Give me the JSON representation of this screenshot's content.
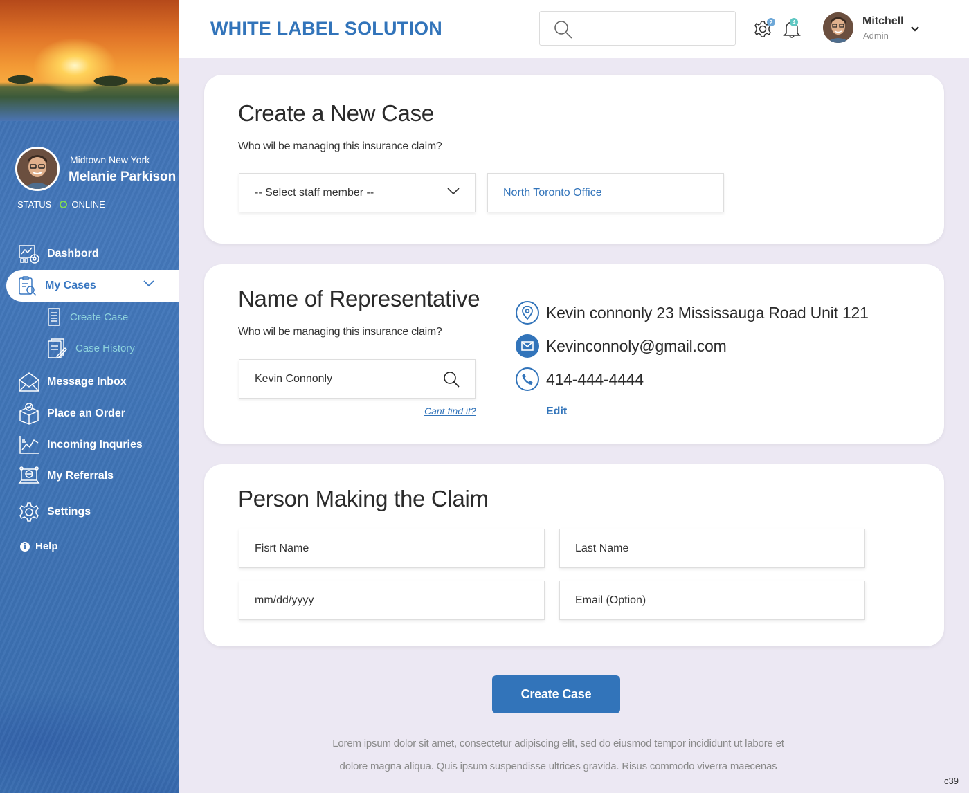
{
  "header": {
    "brand": "WHITE LABEL SOLUTION",
    "search_placeholder": "",
    "settings_badge": "2",
    "notifications_badge": "4",
    "user_name": "Mitchell",
    "user_role": "Admin"
  },
  "sidebar": {
    "location": "Midtown New York",
    "name": "Melanie Parkison",
    "status_label": "STATUS",
    "status_value": "ONLINE",
    "items": [
      {
        "label": "Dashbord",
        "icon": "dashboard-icon"
      },
      {
        "label": "My Cases",
        "icon": "cases-icon"
      },
      {
        "label": "Create Case",
        "icon": "document-icon"
      },
      {
        "label": "Case History",
        "icon": "history-icon"
      },
      {
        "label": "Message Inbox",
        "icon": "envelope-icon"
      },
      {
        "label": "Place an Order",
        "icon": "package-icon"
      },
      {
        "label": "Incoming Inquries",
        "icon": "chart-icon"
      },
      {
        "label": "My Referrals",
        "icon": "referrals-icon"
      },
      {
        "label": "Settings",
        "icon": "gear-icon"
      },
      {
        "label": "Help",
        "icon": "info-icon"
      }
    ]
  },
  "create_case": {
    "title": "Create a New Case",
    "question": "Who wil be managing this insurance claim?",
    "staff_select": "-- Select staff member --",
    "office": "North Toronto Office"
  },
  "representative": {
    "title": "Name of Representative",
    "question": "Who wil be managing this insurance claim?",
    "search_value": "Kevin Connonly",
    "cant_find": "Cant find it?",
    "address": "Kevin connonly 23 Mississauga Road Unit 121",
    "email": "Kevinconnoly@gmail.com",
    "phone": "414-444-4444",
    "edit": "Edit"
  },
  "claimant": {
    "title": "Person Making the Claim",
    "first_name_placeholder": "Fisrt Name",
    "last_name_placeholder": "Last Name",
    "dob_placeholder": "mm/dd/yyyy",
    "email_placeholder": "Email (Option)"
  },
  "actions": {
    "create_button": "Create Case"
  },
  "footer": {
    "line1": "Lorem ipsum dolor sit amet, consectetur adipiscing elit, sed do eiusmod tempor incididunt ut labore et",
    "line2": "dolore magna aliqua. Quis ipsum suspendisse ultrices gravida. Risus commodo viverra maecenas",
    "tag": "c39"
  },
  "colors": {
    "accent": "#3274ba",
    "sidebar": "#3f74b6",
    "online": "#7ed957",
    "background": "#ece8f3"
  }
}
